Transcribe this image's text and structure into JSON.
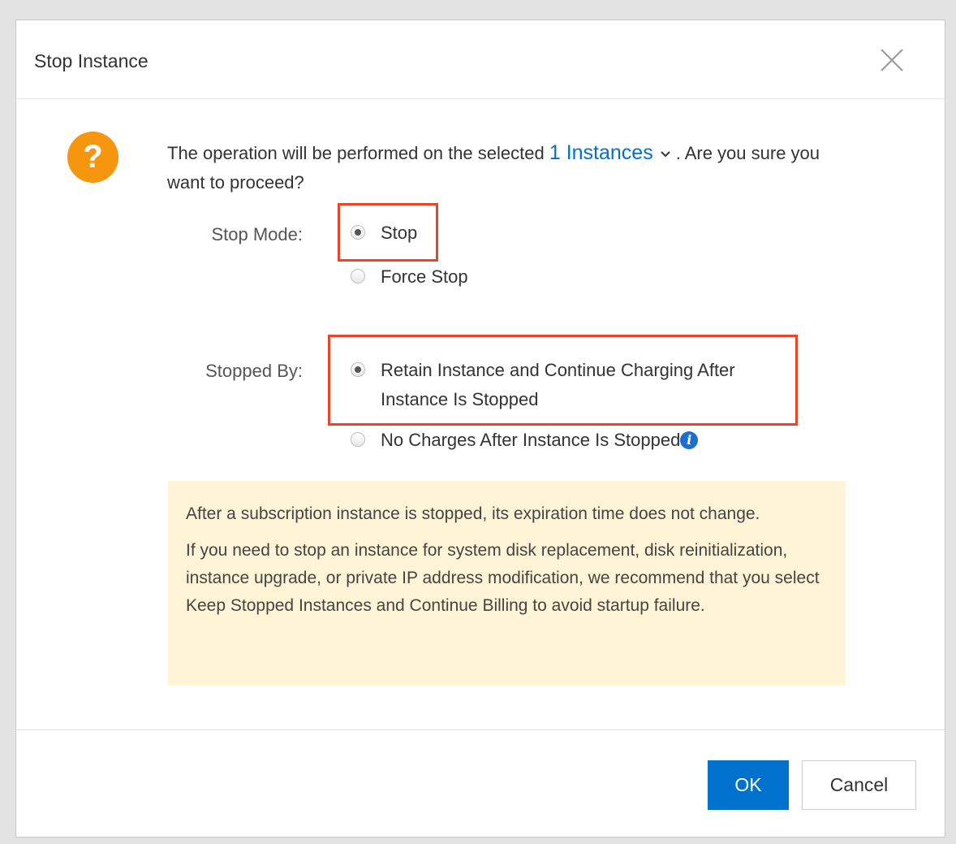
{
  "dialog": {
    "title": "Stop Instance",
    "close_icon": "close-icon"
  },
  "message": {
    "prefix": "The operation will be performed on the selected",
    "instances_link": "1 Instances",
    "suffix": ". Are you sure you want to proceed?"
  },
  "stop_mode": {
    "label": "Stop Mode:",
    "options": [
      {
        "label": "Stop",
        "checked": true
      },
      {
        "label": "Force Stop",
        "checked": false
      }
    ]
  },
  "stopped_by": {
    "label": "Stopped By:",
    "options": [
      {
        "label_line1": "Retain Instance and Continue Charging After",
        "label_line2": "Instance Is Stopped",
        "checked": true
      },
      {
        "label": "No Charges After Instance Is Stopped",
        "checked": false
      }
    ]
  },
  "notice": {
    "paragraphs": [
      "After a subscription instance is stopped, its expiration time does not change.",
      "If you need to stop an instance for system disk replacement, disk reinitialization, instance upgrade, or private IP address modification, we recommend that you select Keep Stopped Instances and Continue Billing to avoid startup failure."
    ]
  },
  "footer": {
    "ok_label": "OK",
    "cancel_label": "Cancel"
  },
  "colors": {
    "highlight": "#e8452b",
    "primary": "#0071cd",
    "question_icon": "#f6960f",
    "notice_bg": "#fff4d6"
  },
  "icons": {
    "question": "question-icon",
    "chevron": "chevron-down-icon",
    "info": "info-icon"
  }
}
